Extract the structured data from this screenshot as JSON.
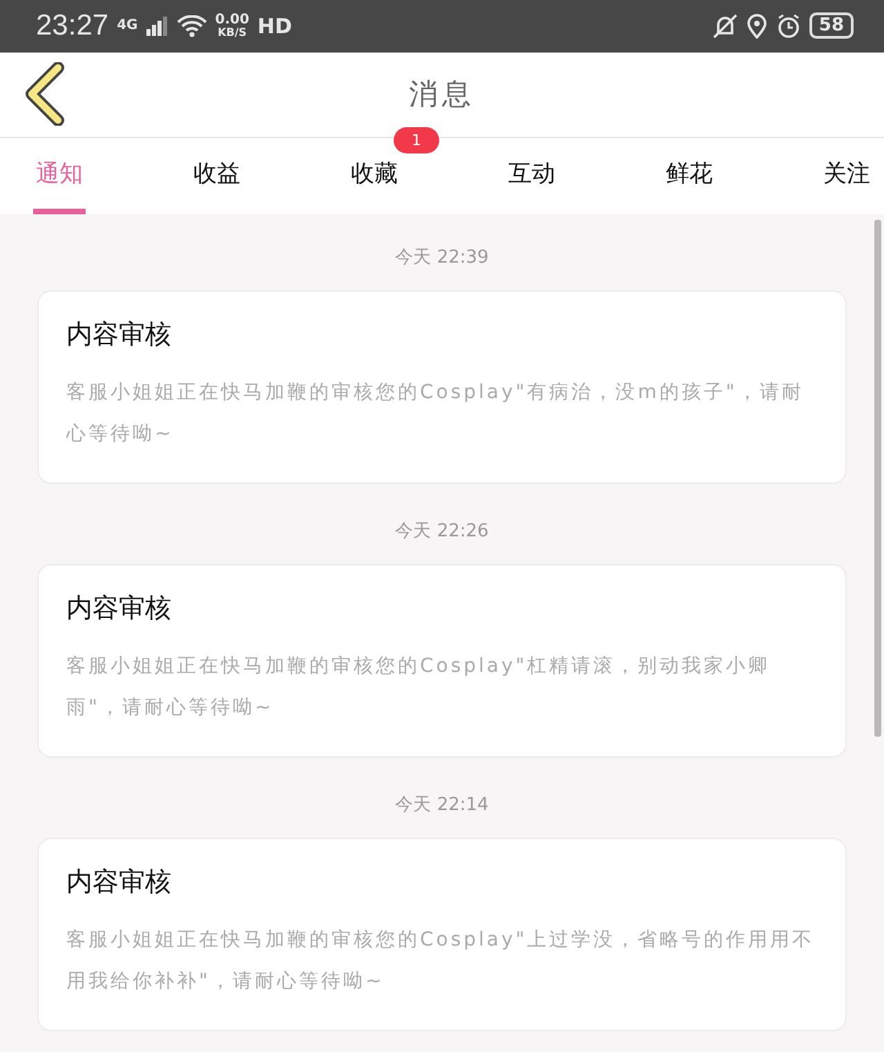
{
  "status_bar": {
    "time": "23:27",
    "network": "4G",
    "speed": "0.00",
    "speed_unit": "KB/S",
    "hd": "HD",
    "battery": "58"
  },
  "header": {
    "title": "消息"
  },
  "tabs": [
    {
      "label": "通知",
      "selected": true
    },
    {
      "label": "收益",
      "selected": false
    },
    {
      "label": "收藏",
      "selected": false,
      "badge": "1"
    },
    {
      "label": "互动",
      "selected": false
    },
    {
      "label": "鲜花",
      "selected": false
    },
    {
      "label": "关注",
      "selected": false
    }
  ],
  "messages": [
    {
      "time": "今天 22:39",
      "title": "内容审核",
      "body": "客服小姐姐正在快马加鞭的审核您的Cosplay\"有病治，没m的孩子\"，请耐心等待呦~"
    },
    {
      "time": "今天 22:26",
      "title": "内容审核",
      "body": "客服小姐姐正在快马加鞭的审核您的Cosplay\"杠精请滚，别动我家小卿雨\"，请耐心等待呦~"
    },
    {
      "time": "今天 22:14",
      "title": "内容审核",
      "body": "客服小姐姐正在快马加鞭的审核您的Cosplay\"上过学没，省略号的作用用不用我给你补补\"，请耐心等待呦~"
    }
  ]
}
